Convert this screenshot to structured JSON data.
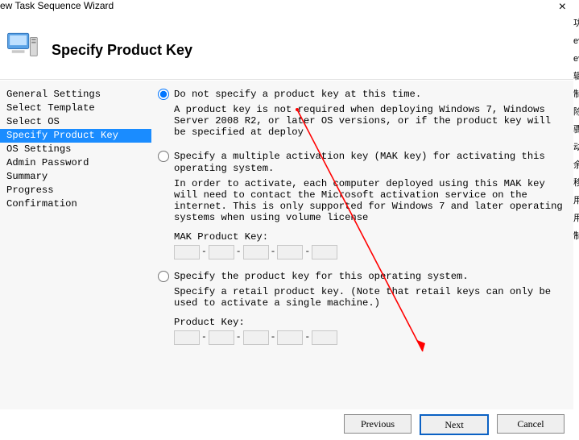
{
  "window": {
    "title": "ew Task Sequence Wizard",
    "close_glyph": "×"
  },
  "header": {
    "page_title": "Specify Product Key"
  },
  "sidebar": {
    "items": [
      {
        "label": "General Settings",
        "selected": false
      },
      {
        "label": "Select Template",
        "selected": false
      },
      {
        "label": "Select OS",
        "selected": false
      },
      {
        "label": "Specify Product Key",
        "selected": true
      },
      {
        "label": "OS Settings",
        "selected": false
      },
      {
        "label": "Admin Password",
        "selected": false
      },
      {
        "label": "Summary",
        "selected": false
      },
      {
        "label": "Progress",
        "selected": false
      },
      {
        "label": "Confirmation",
        "selected": false
      }
    ]
  },
  "options": {
    "opt1": {
      "label": "Do not specify a product key at this time.",
      "desc": "A product key is not required when deploying Windows 7, Windows Server 2008 R2, or later OS versions, or if the product key will be specified at deploy"
    },
    "opt2": {
      "label": "Specify a multiple activation key (MAK key) for activating this operating system.",
      "desc": "In order to activate, each computer deployed using this MAK key will need to contact the Microsoft activation service on the internet.  This is only supported for Windows 7 and later operating systems when using volume license",
      "field_label": "MAK Product Key:"
    },
    "opt3": {
      "label": "Specify the product key for this operating system.",
      "desc": "Specify a retail product key.  (Note that retail keys can only be used to activate a single machine.)",
      "field_label": "Product Key:"
    },
    "dash": "-"
  },
  "footer": {
    "previous": "Previous",
    "next": "Next",
    "cancel": "Cancel"
  },
  "right_strip": {
    "items": [
      "功",
      "ev",
      "ev",
      "辑",
      "制",
      "除",
      "骤",
      "动",
      "余",
      "移",
      "用",
      "用",
      "制"
    ]
  }
}
